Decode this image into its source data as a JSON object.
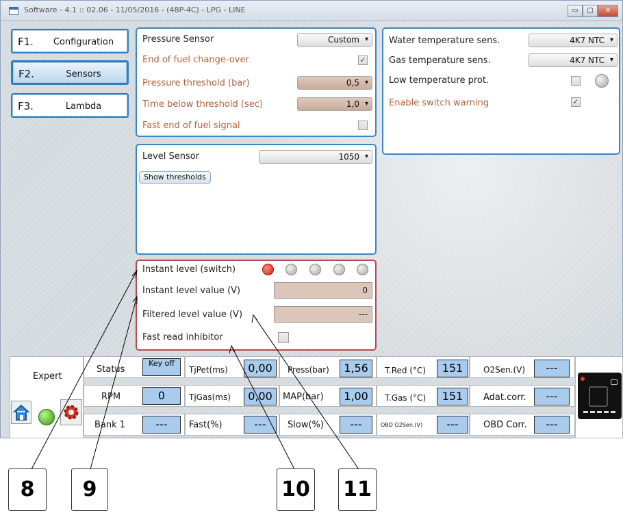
{
  "window": {
    "title": "Software - 4.1 :: 02.06 - 11/05/2016 - (48P-4C) - LPG - LINE",
    "btn_min": "▭",
    "btn_max": "▢",
    "btn_close": "✕"
  },
  "nav": [
    {
      "key": "F1.",
      "label": "Configuration"
    },
    {
      "key": "F2.",
      "label": "Sensors"
    },
    {
      "key": "F3.",
      "label": "Lambda"
    }
  ],
  "pressure": {
    "sensor_label": "Pressure Sensor",
    "sensor_value": "Custom",
    "eof_label": "End of fuel change-over",
    "eof_checked": "✓",
    "thr_label": "Pressure threshold (bar)",
    "thr_value": "0,5",
    "time_label": "Time below threshold (sec)",
    "time_value": "1,0",
    "fast_label": "Fast end of fuel signal"
  },
  "temp": {
    "water_label": "Water temperature sens.",
    "water_value": "4K7 NTC",
    "gas_label": "Gas temperature sens.",
    "gas_value": "4K7 NTC",
    "low_label": "Low temperature prot.",
    "warn_label": "Enable switch warning",
    "warn_checked": "✓"
  },
  "level": {
    "sensor_label": "Level Sensor",
    "sensor_value": "1050",
    "show_btn": "Show thresholds"
  },
  "instant": {
    "switch_label": "Instant level (switch)",
    "value_label": "Instant level value (V)",
    "value": "0",
    "filtered_label": "Filtered level value (V)",
    "filtered_value": "---",
    "inhib_label": "Fast read inhibitor"
  },
  "status": {
    "expert": "Expert",
    "col1": [
      {
        "label": "Status",
        "value": "Key off"
      },
      {
        "label": "RPM",
        "value": "0"
      },
      {
        "label": "Bank 1",
        "value": "---"
      }
    ],
    "col2": [
      {
        "label": "TjPet(ms)",
        "value": "0,00"
      },
      {
        "label": "TjGas(ms)",
        "value": "0,00"
      },
      {
        "label": "Fast(%)",
        "value": "---"
      }
    ],
    "col3": [
      {
        "label": "Press(bar)",
        "value": "1,56"
      },
      {
        "label": "MAP(bar)",
        "value": "1,00"
      },
      {
        "label": "Slow(%)",
        "value": "---"
      }
    ],
    "col4": [
      {
        "label": "T.Red (°C)",
        "value": "151"
      },
      {
        "label": "T.Gas (°C)",
        "value": "151"
      },
      {
        "label": "OBD O2Sen.(V)",
        "value": "---"
      }
    ],
    "col5": [
      {
        "label": "O2Sen.(V)",
        "value": "---"
      },
      {
        "label": "Adat.corr.",
        "value": "---"
      },
      {
        "label": "OBD Corr.",
        "value": "---"
      }
    ]
  },
  "callouts": [
    "8",
    "9",
    "10",
    "11"
  ]
}
